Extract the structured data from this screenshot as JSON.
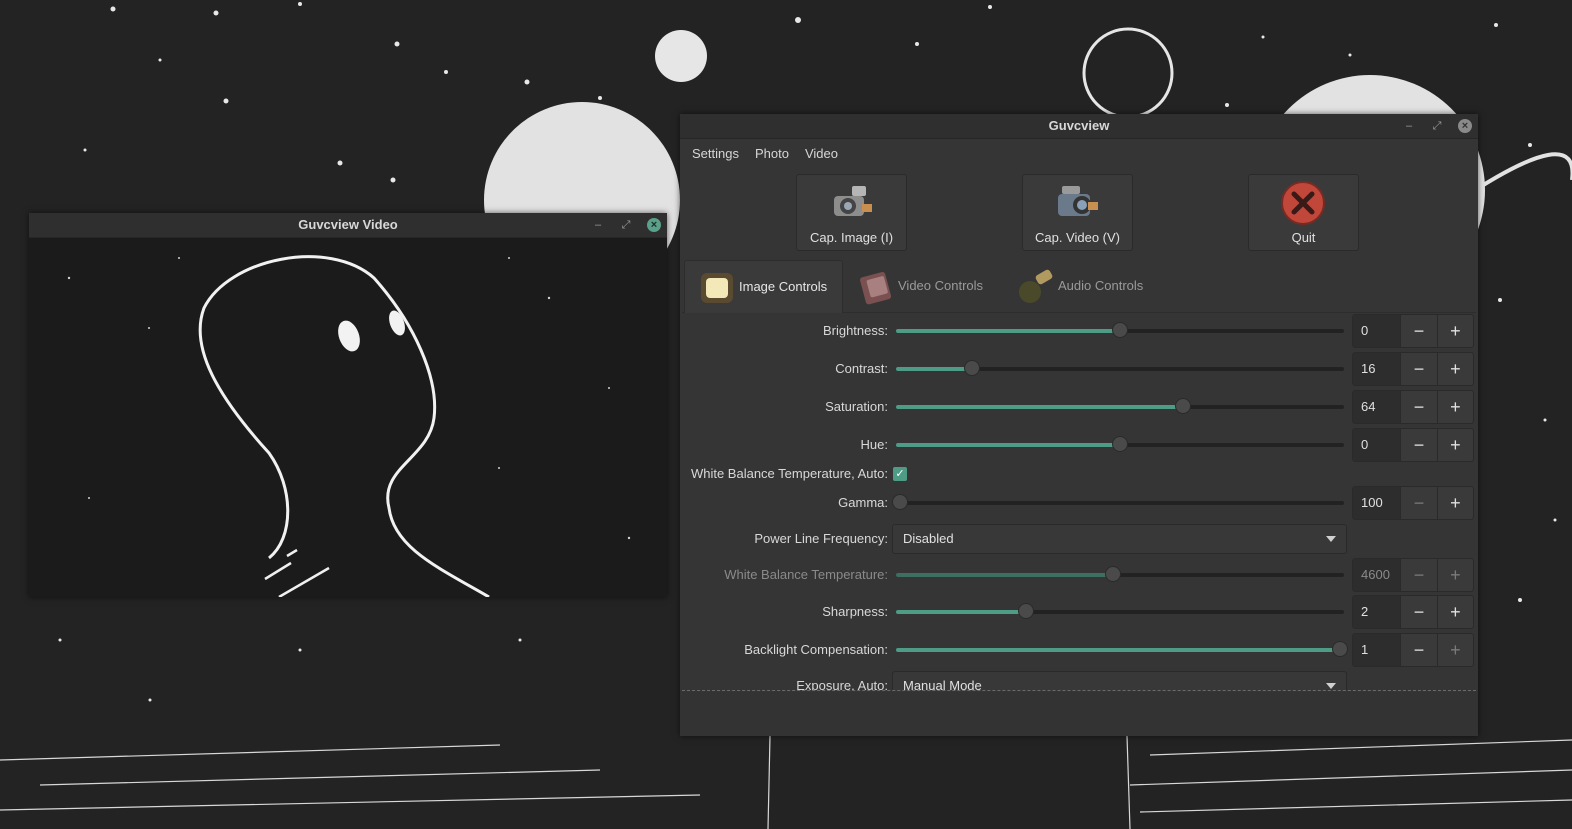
{
  "video_window": {
    "title": "Guvcview Video"
  },
  "main_window": {
    "title": "Guvcview",
    "menu": [
      "Settings",
      "Photo",
      "Video"
    ],
    "toolbar": [
      {
        "label": "Cap. Image (I)",
        "icon": "camera-icon"
      },
      {
        "label": "Cap. Video (V)",
        "icon": "video-camera-icon"
      },
      {
        "label": "Quit",
        "icon": "quit-icon"
      }
    ],
    "tabs": [
      {
        "label": "Image Controls",
        "icon": "image-controls-icon",
        "active": true
      },
      {
        "label": "Video Controls",
        "icon": "video-controls-icon",
        "active": false
      },
      {
        "label": "Audio Controls",
        "icon": "microphone-icon",
        "active": false
      }
    ],
    "controls": {
      "brightness": {
        "label": "Brightness:",
        "value": "0",
        "fraction": 0.5
      },
      "contrast": {
        "label": "Contrast:",
        "value": "16",
        "fraction": 0.17
      },
      "saturation": {
        "label": "Saturation:",
        "value": "64",
        "fraction": 0.64
      },
      "hue": {
        "label": "Hue:",
        "value": "0",
        "fraction": 0.5
      },
      "wb_auto": {
        "label": "White Balance Temperature, Auto:",
        "checked": true
      },
      "gamma": {
        "label": "Gamma:",
        "value": "100",
        "fraction": 0.01
      },
      "power_line": {
        "label": "Power Line Frequency:",
        "value": "Disabled"
      },
      "wb_temp": {
        "label": "White Balance Temperature:",
        "value": "4600",
        "fraction": 0.485
      },
      "sharpness": {
        "label": "Sharpness:",
        "value": "2",
        "fraction": 0.29
      },
      "backlight": {
        "label": "Backlight Compensation:",
        "value": "1",
        "fraction": 0.99
      },
      "exposure_auto": {
        "label": "Exposure, Auto:",
        "value": "Manual Mode"
      }
    },
    "spin_minus": "−",
    "spin_plus": "+"
  },
  "colors": {
    "accent": "#4f9c86",
    "window_bg": "#353535",
    "titlebar": "#2f2f2f"
  }
}
